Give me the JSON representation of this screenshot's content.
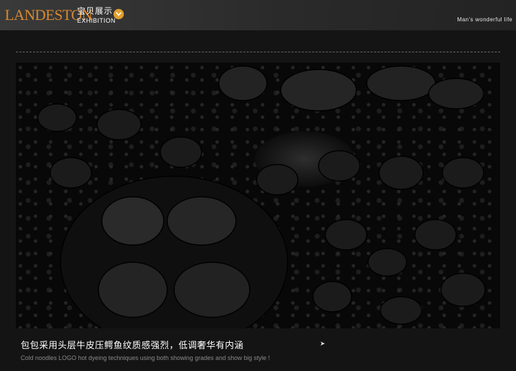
{
  "header": {
    "brand": "LANDESTON",
    "exhibition_cn": "宝贝展示",
    "exhibition_en": "EXHIBITION",
    "tagline": "Man's wonderful life",
    "icon": "chevron-down-circle-icon",
    "accent_color": "#e2a02e",
    "brand_color": "#d98a2f"
  },
  "photo": {
    "subject": ""
  },
  "caption": {
    "cn": "包包采用头层牛皮压鳄鱼纹质感强烈，低调奢华有内涵",
    "arrow": "➤",
    "en": "Cold noodles LOGO hot dyeing techniques using both showing grades and show big style !"
  }
}
